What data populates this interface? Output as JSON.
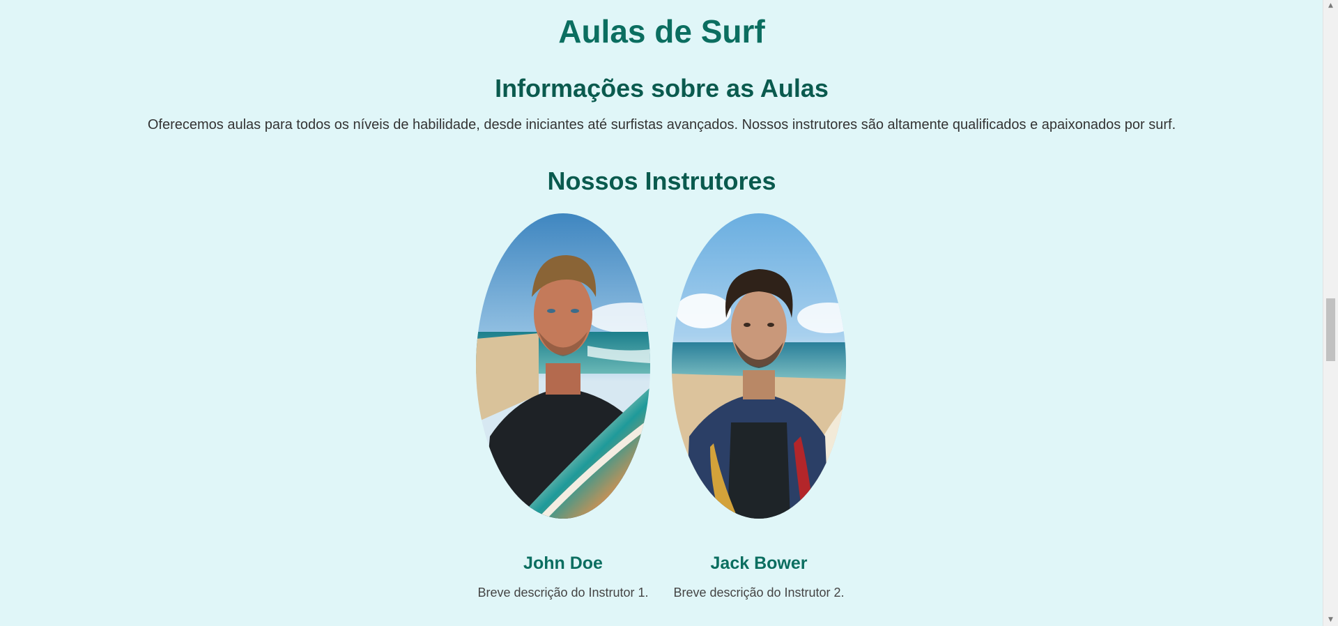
{
  "page": {
    "title": "Aulas de Surf"
  },
  "info": {
    "heading": "Informações sobre as Aulas",
    "text": "Oferecemos aulas para todos os níveis de habilidade, desde iniciantes até surfistas avançados. Nossos instrutores são altamente qualificados e apaixonados por surf."
  },
  "instructors": {
    "heading": "Nossos Instrutores",
    "items": [
      {
        "name": "John Doe",
        "description": "Breve descrição do Instrutor 1."
      },
      {
        "name": "Jack Bower",
        "description": "Breve descrição do Instrutor 2."
      }
    ]
  },
  "scrollbar": {
    "up_icon": "chevron-up-icon",
    "down_icon": "chevron-down-icon",
    "position": 0.55
  },
  "colors": {
    "background": "#e0f6f8",
    "title": "#0b6e60",
    "heading": "#0a5a4e"
  }
}
